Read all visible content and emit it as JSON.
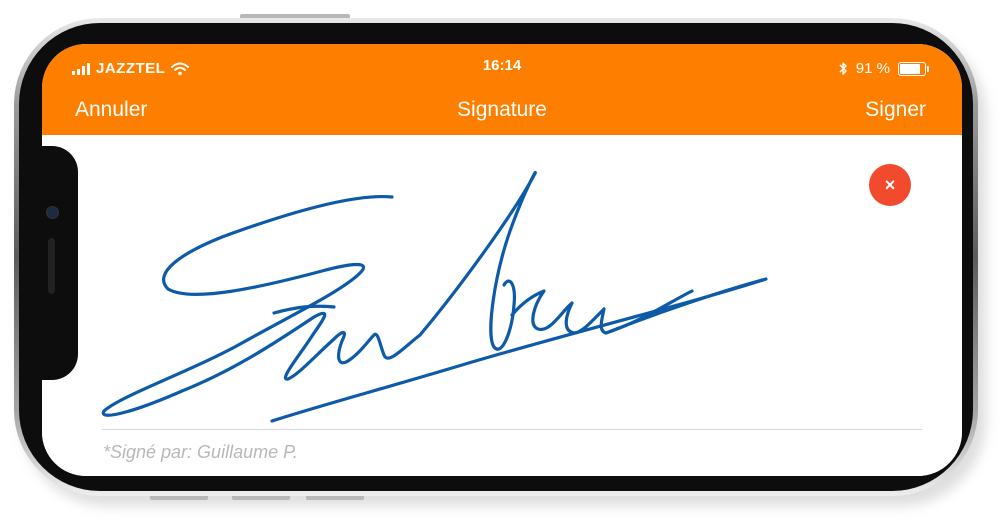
{
  "status_bar": {
    "carrier": "JAZZTEL",
    "time": "16:14",
    "battery_text": "91 %",
    "battery_level": 0.91,
    "icons": [
      "signal-icon",
      "wifi-icon",
      "bluetooth-icon",
      "battery-icon"
    ]
  },
  "nav": {
    "cancel_label": "Annuler",
    "title": "Signature",
    "sign_label": "Signer"
  },
  "signature": {
    "clear_icon": "×",
    "signed_by": "*Signé par: Guillaume P."
  },
  "colors": {
    "accent": "#fe7f00",
    "clear_button": "#f14a2c",
    "ink": "#0d5aa8"
  }
}
